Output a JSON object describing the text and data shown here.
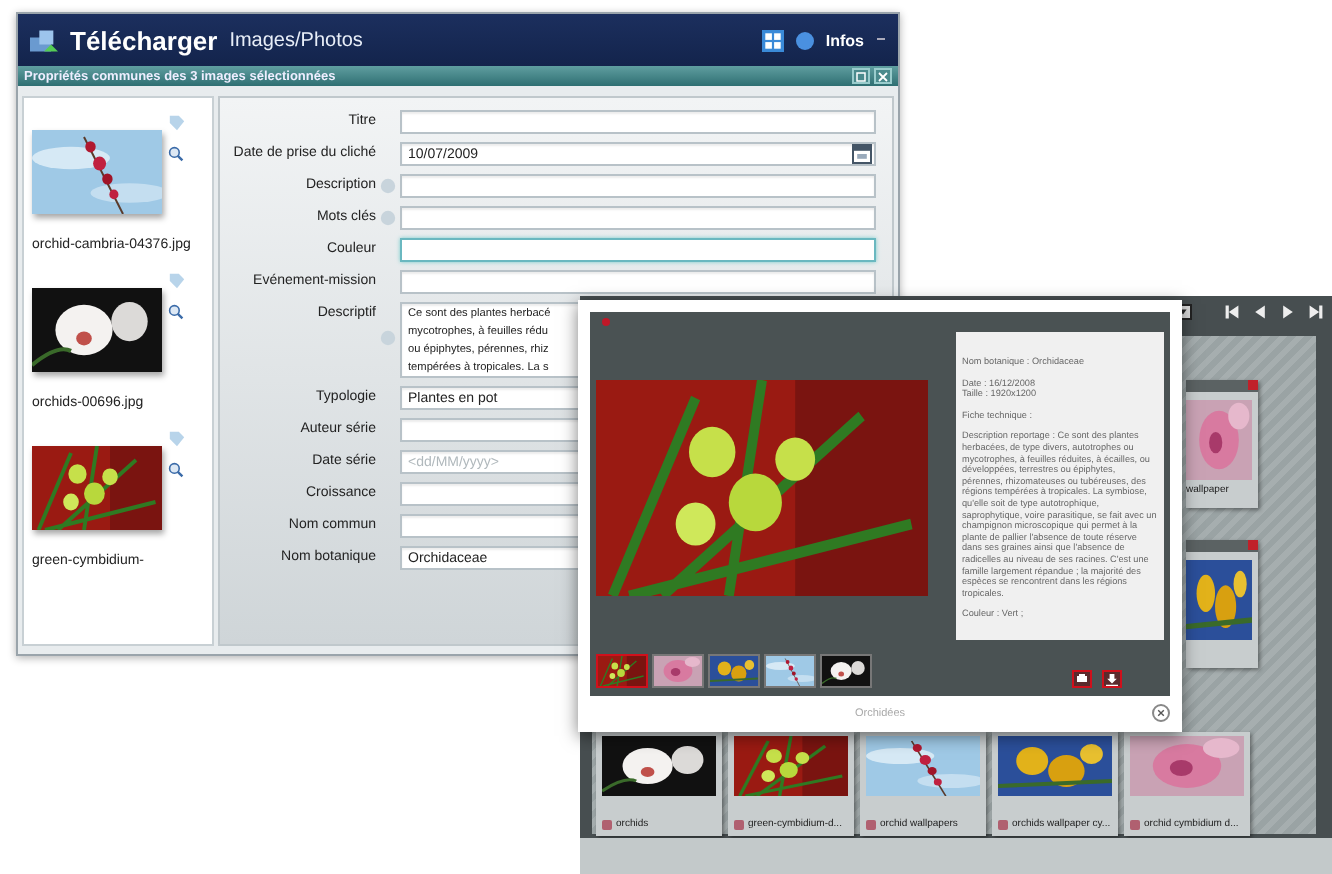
{
  "app": {
    "title": "Télécharger",
    "section": "Images/Photos",
    "infos": "Infos"
  },
  "panel": {
    "title": "Propriétés communes des 3 images sélectionnées"
  },
  "images": [
    {
      "filename": "orchid-cambria-04376.jpg"
    },
    {
      "filename": "orchids-00696.jpg"
    },
    {
      "filename": "green-cymbidium-"
    }
  ],
  "fields": [
    {
      "label": "Titre",
      "kind": "text",
      "info": false,
      "focused": false
    },
    {
      "label": "Date de prise du cliché",
      "kind": "date",
      "value": "10/07/2009",
      "info": false,
      "focused": false
    },
    {
      "label": "Description",
      "kind": "text",
      "info": true,
      "focused": false
    },
    {
      "label": "Mots clés",
      "kind": "text",
      "info": true,
      "focused": false
    },
    {
      "label": "Couleur",
      "kind": "text",
      "info": false,
      "focused": true
    },
    {
      "label": "Evénement-mission",
      "kind": "text",
      "info": false,
      "focused": false
    },
    {
      "label": "Descriptif",
      "kind": "textarea",
      "lines": [
        "Ce sont des plantes herbacé",
        "mycotrophes, à feuilles rédu",
        "ou épiphytes, pérennes, rhiz",
        "tempérées à tropicales. La s"
      ],
      "info": true,
      "focused": false
    },
    {
      "label": "Typologie",
      "kind": "text",
      "value": "Plantes en pot",
      "info": false,
      "focused": false
    },
    {
      "label": "Auteur série",
      "kind": "text",
      "info": false,
      "focused": false
    },
    {
      "label": "Date série",
      "kind": "text",
      "placeholder": "<dd/MM/yyyy>",
      "info": false,
      "focused": false
    },
    {
      "label": "Croissance",
      "kind": "text",
      "info": false,
      "focused": false
    },
    {
      "label": "Nom commun",
      "kind": "text",
      "info": false,
      "focused": false
    },
    {
      "label": "Nom botanique",
      "kind": "text",
      "value": "Orchidaceae",
      "info": false,
      "focused": false
    }
  ],
  "gallery": {
    "side_captions": [
      "wallpaper"
    ],
    "captions": [
      "orchids",
      "green-cymbidium-d...",
      "orchid wallpapers",
      "orchids wallpaper cy...",
      "orchid cymbidium d..."
    ]
  },
  "lightbox": {
    "info": [
      "Nom botanique : Orchidaceae",
      "Date : 16/12/2008\nTaille : 1920x1200",
      "Fiche technique :",
      "Description reportage : Ce sont des plantes herbacées, de type divers, autotrophes ou mycotrophes, à feuilles réduites, à écailles, ou développées, terrestres ou épiphytes, pérennes, rhizomateuses ou tubéreuses, des régions tempérées à tropicales. La symbiose, qu'elle soit de type autotrophique, saprophytique, voire parasitique, se fait avec un champignon microscopique qui permet à la plante de pallier l'absence de toute réserve dans ses graines ainsi que l'absence de radicelles au niveau de ses racines. C'est une famille largement répandue ; la majorité des espèces se rencontrent dans les régions tropicales.",
      "Couleur : Vert ;"
    ],
    "thumbnails": [
      {
        "selected": true
      },
      {
        "selected": false
      },
      {
        "selected": false
      },
      {
        "selected": false
      },
      {
        "selected": false
      }
    ],
    "caption": "Orchidées"
  }
}
